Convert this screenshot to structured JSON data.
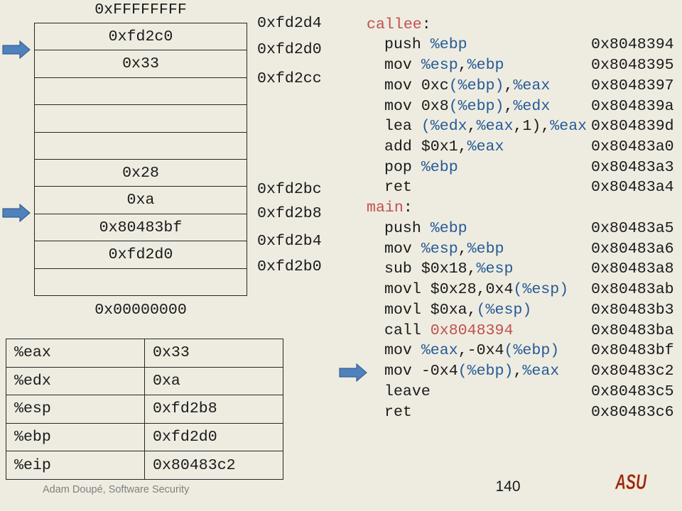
{
  "colors": {
    "background": "#EEECE1",
    "text": "#1A1A1A",
    "register": "#265A96",
    "label": "#C0504D",
    "arrow_fill": "#4F81BD",
    "arrow_stroke": "#3A5F8F",
    "border": "#262626",
    "footer_text": "#7F7F7F",
    "logo_maroon": "#8C1D40",
    "logo_gold": "#FFC627"
  },
  "stack": {
    "top_label": "0xFFFFFFFF",
    "bottom_label": "0x00000000",
    "cells": [
      "0xfd2c0",
      "0x33",
      "",
      "",
      "",
      "0x28",
      "0xa",
      "0x80483bf",
      "0xfd2d0",
      ""
    ],
    "address_labels": [
      "0xfd2d4",
      "0xfd2d0",
      "0xfd2cc",
      "0xfd2bc",
      "0xfd2b8",
      "0xfd2b4",
      "0xfd2b0"
    ]
  },
  "registers": [
    {
      "name": "%eax",
      "value": "0x33"
    },
    {
      "name": "%edx",
      "value": "0xa"
    },
    {
      "name": "%esp",
      "value": "0xfd2b8"
    },
    {
      "name": "%ebp",
      "value": "0xfd2d0"
    },
    {
      "name": "%eip",
      "value": "0x80483c2"
    }
  ],
  "code": {
    "lines": [
      {
        "tokens": [
          {
            "text": "callee",
            "kind": "label"
          },
          {
            "text": ":",
            "kind": "plain"
          }
        ]
      },
      {
        "tokens": [
          {
            "text": "push ",
            "kind": "plain"
          },
          {
            "text": "%ebp",
            "kind": "register"
          }
        ],
        "addr": "0x8048394"
      },
      {
        "tokens": [
          {
            "text": "mov ",
            "kind": "plain"
          },
          {
            "text": "%esp",
            "kind": "register"
          },
          {
            "text": ",",
            "kind": "plain"
          },
          {
            "text": "%ebp",
            "kind": "register"
          }
        ],
        "addr": "0x8048395"
      },
      {
        "tokens": [
          {
            "text": "mov 0xc",
            "kind": "plain"
          },
          {
            "text": "(%ebp)",
            "kind": "register"
          },
          {
            "text": ",",
            "kind": "plain"
          },
          {
            "text": "%eax",
            "kind": "register"
          }
        ],
        "addr": "0x8048397"
      },
      {
        "tokens": [
          {
            "text": "mov 0x8",
            "kind": "plain"
          },
          {
            "text": "(%ebp)",
            "kind": "register"
          },
          {
            "text": ",",
            "kind": "plain"
          },
          {
            "text": "%edx",
            "kind": "register"
          }
        ],
        "addr": "0x804839a"
      },
      {
        "tokens": [
          {
            "text": "lea ",
            "kind": "plain"
          },
          {
            "text": "(%edx",
            "kind": "register"
          },
          {
            "text": ",",
            "kind": "plain"
          },
          {
            "text": "%eax",
            "kind": "register"
          },
          {
            "text": ",1),",
            "kind": "plain"
          },
          {
            "text": "%eax",
            "kind": "register"
          }
        ],
        "addr": "0x804839d"
      },
      {
        "tokens": [
          {
            "text": "add $0x1,",
            "kind": "plain"
          },
          {
            "text": "%eax",
            "kind": "register"
          }
        ],
        "addr": "0x80483a0"
      },
      {
        "tokens": [
          {
            "text": "pop ",
            "kind": "plain"
          },
          {
            "text": "%ebp",
            "kind": "register"
          }
        ],
        "addr": "0x80483a3"
      },
      {
        "tokens": [
          {
            "text": "ret",
            "kind": "plain"
          }
        ],
        "addr": "0x80483a4"
      },
      {
        "tokens": [
          {
            "text": "main",
            "kind": "label"
          },
          {
            "text": ":",
            "kind": "plain"
          }
        ]
      },
      {
        "tokens": [
          {
            "text": "push ",
            "kind": "plain"
          },
          {
            "text": "%ebp",
            "kind": "register"
          }
        ],
        "addr": "0x80483a5"
      },
      {
        "tokens": [
          {
            "text": "mov ",
            "kind": "plain"
          },
          {
            "text": "%esp",
            "kind": "register"
          },
          {
            "text": ",",
            "kind": "plain"
          },
          {
            "text": "%ebp",
            "kind": "register"
          }
        ],
        "addr": "0x80483a6"
      },
      {
        "tokens": [
          {
            "text": "sub $0x18,",
            "kind": "plain"
          },
          {
            "text": "%esp",
            "kind": "register"
          }
        ],
        "addr": "0x80483a8"
      },
      {
        "tokens": [
          {
            "text": "movl $0x28,0x4",
            "kind": "plain"
          },
          {
            "text": "(%esp)",
            "kind": "register"
          }
        ],
        "addr": "0x80483ab"
      },
      {
        "tokens": [
          {
            "text": "movl $0xa,",
            "kind": "plain"
          },
          {
            "text": "(%esp)",
            "kind": "register"
          }
        ],
        "addr": "0x80483b3"
      },
      {
        "tokens": [
          {
            "text": "call ",
            "kind": "plain"
          },
          {
            "text": "0x8048394",
            "kind": "label"
          }
        ],
        "addr": "0x80483ba"
      },
      {
        "tokens": [
          {
            "text": "mov ",
            "kind": "plain"
          },
          {
            "text": "%eax",
            "kind": "register"
          },
          {
            "text": ",-0x4",
            "kind": "plain"
          },
          {
            "text": "(%ebp)",
            "kind": "register"
          }
        ],
        "addr": "0x80483bf"
      },
      {
        "tokens": [
          {
            "text": "mov -0x4",
            "kind": "plain"
          },
          {
            "text": "(%ebp)",
            "kind": "register"
          },
          {
            "text": ",",
            "kind": "plain"
          },
          {
            "text": "%eax",
            "kind": "register"
          }
        ],
        "addr": "0x80483c2"
      },
      {
        "tokens": [
          {
            "text": "leave",
            "kind": "plain"
          }
        ],
        "addr": "0x80483c5"
      },
      {
        "tokens": [
          {
            "text": "ret",
            "kind": "plain"
          }
        ],
        "addr": "0x80483c6"
      }
    ]
  },
  "footer": {
    "credit": "Adam Doupé, Software Security",
    "page_number": "140"
  },
  "logo": {
    "text": "ASU"
  }
}
